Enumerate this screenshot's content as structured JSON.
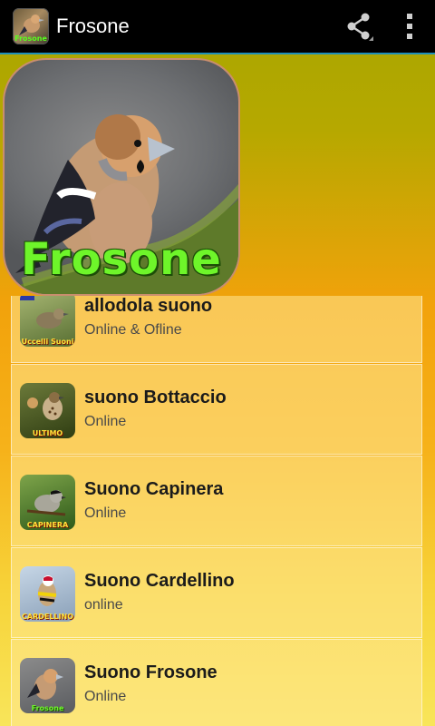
{
  "app": {
    "title": "Frosone",
    "icon_text": "Frosone"
  },
  "actions": {
    "share_icon": "share-icon",
    "overflow_icon": "overflow-menu-icon"
  },
  "hero": {
    "label": "Frosone"
  },
  "list": {
    "items": [
      {
        "title": "allodola suono",
        "subtitle": "Online & Ofline",
        "thumb_label": "Uccelli Suoni",
        "thumb_bg": "#7e9a52"
      },
      {
        "title": "suono Bottaccio",
        "subtitle": "Online",
        "thumb_label": "ULTIMO",
        "thumb_bg": "#5b6b2e"
      },
      {
        "title": "Suono Capinera",
        "subtitle": "Online",
        "thumb_label": "CAPINERA",
        "thumb_bg": "#4f7a2a"
      },
      {
        "title": "Suono Cardellino",
        "subtitle": "online",
        "thumb_label": "CARDELLINO",
        "thumb_bg": "#8fa7c2"
      },
      {
        "title": "Suono Frosone",
        "subtitle": "Online",
        "thumb_label": "Frosone",
        "thumb_bg": "#6d6f72"
      }
    ]
  }
}
